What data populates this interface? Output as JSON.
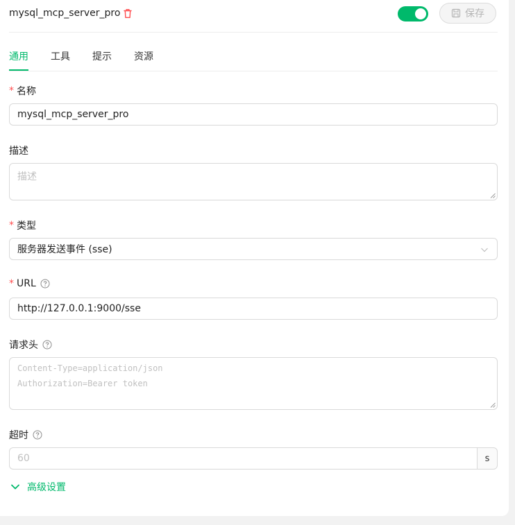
{
  "header": {
    "server_name": "mysql_mcp_server_pro",
    "save_label": "保存",
    "enabled": true,
    "accent_color": "#00b96b"
  },
  "tabs": [
    {
      "label": "通用",
      "active": true
    },
    {
      "label": "工具",
      "active": false
    },
    {
      "label": "提示",
      "active": false
    },
    {
      "label": "资源",
      "active": false
    }
  ],
  "form": {
    "name": {
      "label": "名称",
      "required": true,
      "value": "mysql_mcp_server_pro"
    },
    "description": {
      "label": "描述",
      "required": false,
      "placeholder": "描述"
    },
    "type": {
      "label": "类型",
      "required": true,
      "value": "服务器发送事件 (sse)"
    },
    "url": {
      "label": "URL",
      "required": true,
      "value": "http://127.0.0.1:9000/sse"
    },
    "headers": {
      "label": "请求头",
      "required": false,
      "placeholder_line1": "Content-Type=application/json",
      "placeholder_line2": "Authorization=Bearer token"
    },
    "timeout": {
      "label": "超时",
      "required": false,
      "placeholder": "60",
      "unit": "s"
    },
    "advanced_label": "高级设置"
  },
  "icons": {
    "delete": "trash-icon",
    "save": "save-icon",
    "help": "question-circle-icon",
    "select": "chevron-down-icon",
    "advanced": "chevron-down-icon"
  }
}
